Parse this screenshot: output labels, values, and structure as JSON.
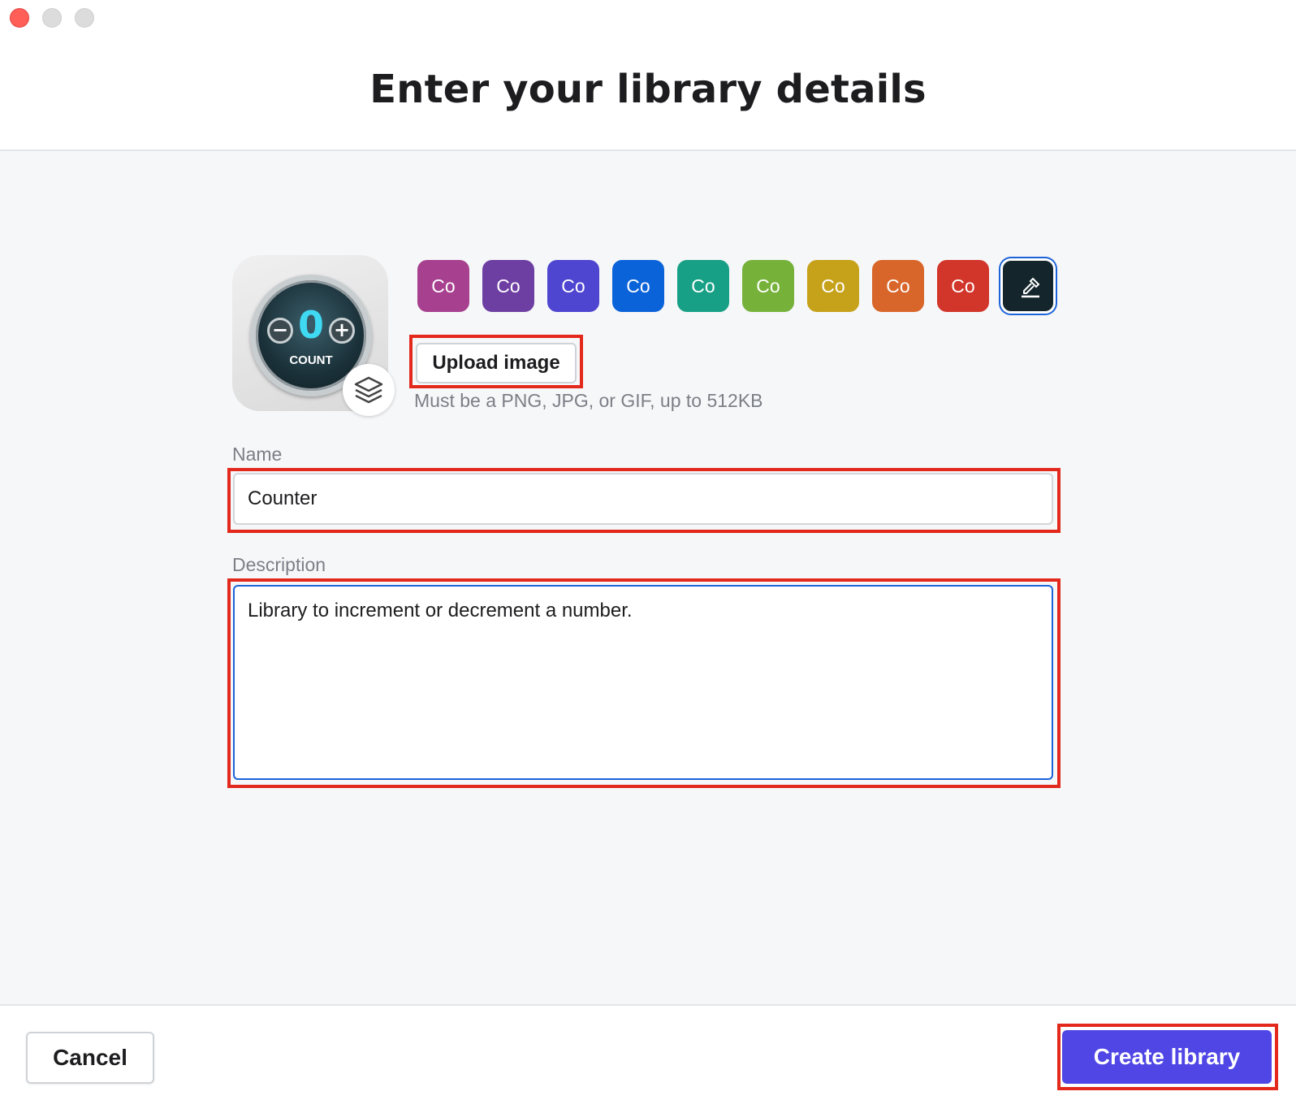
{
  "window": {
    "title": "Enter your library details"
  },
  "avatar": {
    "dial_value": "0",
    "dial_label": "COUNT",
    "minus_symbol": "−",
    "plus_symbol": "+"
  },
  "swatches": [
    {
      "label": "Co",
      "color": "#a7408f"
    },
    {
      "label": "Co",
      "color": "#6e3fa3"
    },
    {
      "label": "Co",
      "color": "#4e45d0"
    },
    {
      "label": "Co",
      "color": "#0b63d9"
    },
    {
      "label": "Co",
      "color": "#17a085"
    },
    {
      "label": "Co",
      "color": "#76b23a"
    },
    {
      "label": "Co",
      "color": "#c6a11a"
    },
    {
      "label": "Co",
      "color": "#d8662a"
    },
    {
      "label": "Co",
      "color": "#d2352a"
    }
  ],
  "custom_color": {
    "icon": "eyedropper-icon",
    "color": "#14262b"
  },
  "upload": {
    "label": "Upload image",
    "hint": "Must be a PNG, JPG, or GIF, up to 512KB"
  },
  "form": {
    "name_label": "Name",
    "name_value": "Counter",
    "description_label": "Description",
    "description_value": "Library to increment or decrement a number."
  },
  "footer": {
    "cancel_label": "Cancel",
    "create_label": "Create library"
  },
  "colors": {
    "accent": "#4f46e5",
    "highlight": "#e3281c",
    "focus": "#1d63d8"
  }
}
